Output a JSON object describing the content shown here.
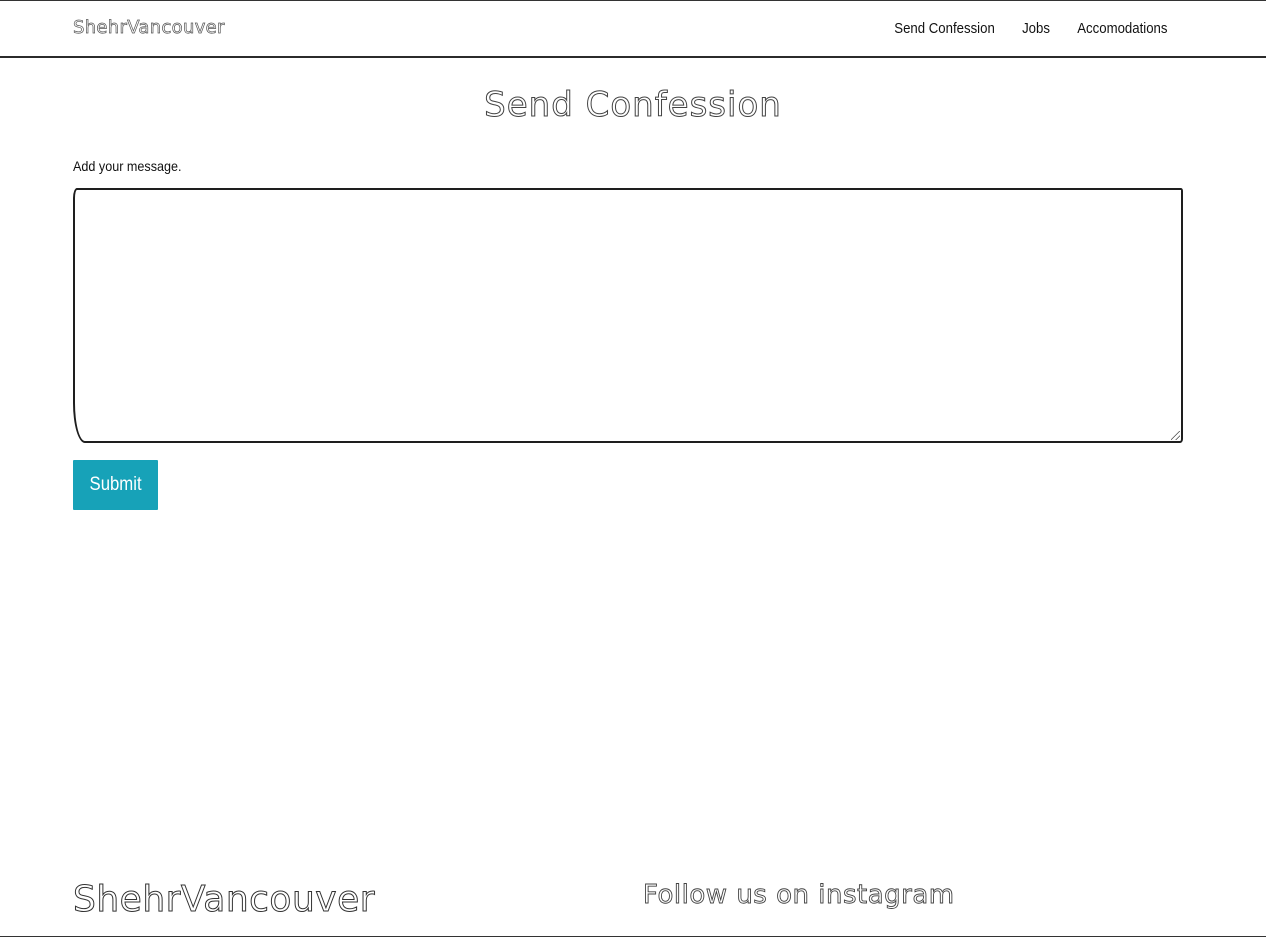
{
  "navbar": {
    "brand": "ShehrVancouver",
    "links": [
      {
        "label": "Send Confession"
      },
      {
        "label": "Jobs"
      },
      {
        "label": "Accomodations"
      }
    ]
  },
  "main": {
    "title": "Send Confession",
    "message_label": "Add your message.",
    "message_value": "",
    "submit_label": "Submit"
  },
  "footer": {
    "brand": "ShehrVancouver",
    "follow_text": "Follow us on instagram"
  },
  "colors": {
    "submit_bg": "#17a2b8",
    "border": "#1e1e1e"
  }
}
